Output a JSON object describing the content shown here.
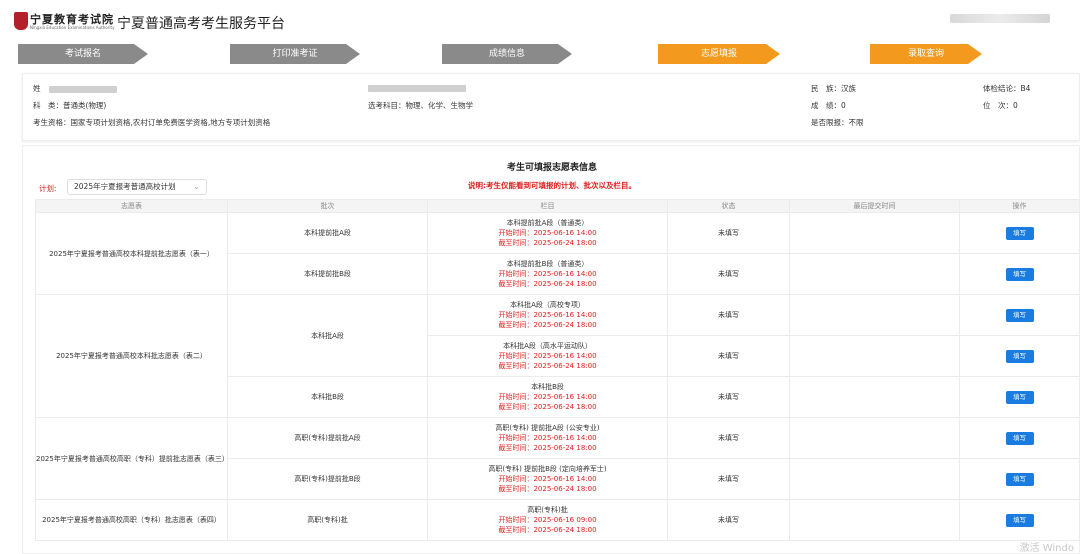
{
  "header": {
    "logo_text": "宁夏教育考试院",
    "logo_sub": "Ningxia Education Examinations Authority",
    "title": "宁夏普通高考考生服务平台"
  },
  "steps": [
    {
      "label": "考试报名",
      "state": "done"
    },
    {
      "label": "打印准考证",
      "state": "done"
    },
    {
      "label": "成绩信息",
      "state": "done"
    },
    {
      "label": "志愿填报",
      "state": "active"
    },
    {
      "label": "录取查询",
      "state": "active"
    }
  ],
  "info": {
    "name_label": "姓",
    "subject_label": "科　类：",
    "subject_value": "普通类(物理)",
    "elective_label": "选考科目：",
    "elective_value": "物理、化学、生物学",
    "qualification_label": "考生资格：",
    "qualification_value": "国家专项计划资格,农村订单免费医学资格,地方专项计划资格",
    "ethnicity_label": "民　族：",
    "ethnicity_value": "汉族",
    "score_label": "成　绩：",
    "score_value": "0",
    "limit_label": "是否限报：",
    "limit_value": "不限",
    "health_label": "体检结论：",
    "health_value": "B4",
    "rank_label": "位　次：",
    "rank_value": "0"
  },
  "panel": {
    "title": "考生可填报志愿表信息",
    "notice": "说明:考生仅能看到可填报的计划、批次以及栏目。",
    "plan_label": "计划:",
    "plan_value": "2025年宁夏报考普通高校计划"
  },
  "table": {
    "headers": [
      "志愿表",
      "批次",
      "栏目",
      "状态",
      "最后提交时间",
      "操作"
    ],
    "start_label": "开始时间：",
    "end_label": "截至时间：",
    "groups": [
      {
        "form": "2025年宁夏报考普通高校本科提前批志愿表（表一）",
        "batches": [
          {
            "name": "本科提前批A段",
            "columns": [
              {
                "name": "本科提前批A段（普通类）",
                "start": "2025-06-16 14:00",
                "end": "2025-06-24 18:00",
                "status": "未填写",
                "btn": "填写"
              }
            ]
          },
          {
            "name": "本科提前批B段",
            "columns": [
              {
                "name": "本科提前批B段（普通类）",
                "start": "2025-06-16 14:00",
                "end": "2025-06-24 18:00",
                "status": "未填写",
                "btn": "填写"
              }
            ]
          }
        ]
      },
      {
        "form": "2025年宁夏报考普通高校本科批志愿表（表二）",
        "batches": [
          {
            "name": "本科批A段",
            "columns": [
              {
                "name": "本科批A段（高校专项）",
                "start": "2025-06-16 14:00",
                "end": "2025-06-24 18:00",
                "status": "未填写",
                "btn": "填写"
              },
              {
                "name": "本科批A段（高水平运动队）",
                "start": "2025-06-16 14:00",
                "end": "2025-06-24 18:00",
                "status": "未填写",
                "btn": "填写"
              }
            ]
          },
          {
            "name": "本科批B段",
            "columns": [
              {
                "name": "本科批B段",
                "start": "2025-06-16 14:00",
                "end": "2025-06-24 18:00",
                "status": "未填写",
                "btn": "填写"
              }
            ]
          }
        ]
      },
      {
        "form": "2025年宁夏报考普通高校高职（专科）提前批志愿表（表三）",
        "batches": [
          {
            "name": "高职(专科)提前批A段",
            "columns": [
              {
                "name": "高职(专科) 提前批A段 (公安专业)",
                "start": "2025-06-16 14:00",
                "end": "2025-06-24 18:00",
                "status": "未填写",
                "btn": "填写"
              }
            ]
          },
          {
            "name": "高职(专科)提前批B段",
            "columns": [
              {
                "name": "高职(专科) 提前批B段 (定向培养军士)",
                "start": "2025-06-16 14:00",
                "end": "2025-06-24 18:00",
                "status": "未填写",
                "btn": "填写"
              }
            ]
          }
        ]
      },
      {
        "form": "2025年宁夏报考普通高校高职（专科）批志愿表（表四）",
        "batches": [
          {
            "name": "高职(专科)批",
            "columns": [
              {
                "name": "高职(专科)批",
                "start": "2025-06-16 09:00",
                "end": "2025-06-24 18:00",
                "status": "未填写",
                "btn": "填写"
              }
            ]
          }
        ]
      }
    ]
  },
  "watermark": "激活 Windo",
  "colors": {
    "accent_blue": "#1a7be0",
    "step_active": "#f39a1e",
    "step_done": "#8a8a8a",
    "alert_red": "#e02020"
  }
}
